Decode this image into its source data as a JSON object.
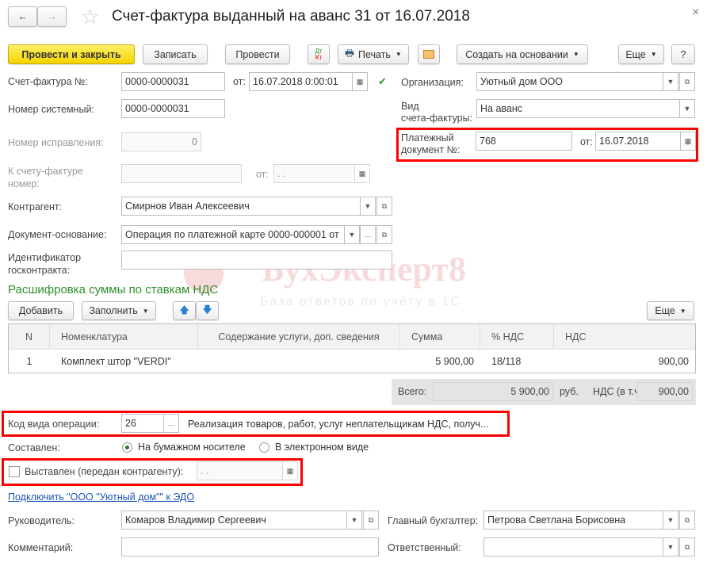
{
  "title": "Счет-фактура выданный на аванс 31 от 16.07.2018",
  "toolbar": {
    "post_close": "Провести и закрыть",
    "save": "Записать",
    "post": "Провести",
    "dtkt_dt": "Дт",
    "dtkt_kt": "Кт",
    "print": "Печать",
    "create_based": "Создать на основании",
    "more": "Еще",
    "help": "?",
    "close": "×"
  },
  "fields": {
    "invoice_no_label": "Счет-фактура №:",
    "invoice_no": "0000-0000031",
    "from_label": "от:",
    "invoice_date": "16.07.2018  0:00:01",
    "system_no_label": "Номер системный:",
    "system_no": "0000-0000031",
    "correction_label": "Номер исправления:",
    "correction": "0",
    "to_invoice_label1": "К счету-фактуре",
    "to_invoice_label2": "номер:",
    "to_invoice_date": " .  .",
    "counterparty_label": "Контрагент:",
    "counterparty": "Смирнов Иван Алексеевич",
    "basis_label": "Документ-основание:",
    "basis": "Операция по платежной карте 0000-000001 от",
    "contract_label1": "Идентификатор",
    "contract_label2": "госконтракта:",
    "contract": "",
    "org_label": "Организация:",
    "org": "Уютный дом ООО",
    "type_label1": "Вид",
    "type_label2": "счета-фактуры:",
    "type": "На аванс",
    "paydoc_label1": "Платежный",
    "paydoc_label2": "документ №:",
    "paydoc": "768",
    "paydoc_date": "16.07.2018"
  },
  "watermark": {
    "name": "БухЭксперт8",
    "tagline": "База ответов по учёту в 1С"
  },
  "section": {
    "title": "Расшифровка суммы по ставкам НДС",
    "add": "Добавить",
    "fill": "Заполнить",
    "more": "Еще"
  },
  "table": {
    "headers": [
      "N",
      "Номенклатура",
      "Содержание услуги, доп. сведения",
      "Сумма",
      "% НДС",
      "НДС"
    ],
    "rows": [
      {
        "n": "1",
        "item": "Комплект штор \"VERDI\"",
        "content": "",
        "sum": "5 900,00",
        "rate": "18/118",
        "vat": "900,00"
      }
    ]
  },
  "totals": {
    "total_label": "Всего:",
    "total": "5 900,00",
    "currency": "руб.",
    "vat_label": "НДС (в т.ч.):",
    "vat": "900,00"
  },
  "operation": {
    "label": "Код вида операции:",
    "code": "26",
    "desc": "Реализация товаров, работ, услуг неплательщикам НДС, получ..."
  },
  "composed": {
    "label": "Составлен:",
    "paper": "На бумажном носителе",
    "electronic": "В электронном виде"
  },
  "issued": {
    "label": "Выставлен (передан контрагенту):",
    "date": " .  ."
  },
  "edo_link": "Подключить \"ООО \"Уютный дом\"\" к ЭДО",
  "bottom": {
    "head_label": "Руководитель:",
    "head": "Комаров Владимир Сергеевич",
    "accountant_label": "Главный бухгалтер:",
    "accountant": "Петрова Светлана Борисовна",
    "comment_label": "Комментарий:",
    "comment": "",
    "responsible_label": "Ответственный:",
    "responsible": ""
  }
}
